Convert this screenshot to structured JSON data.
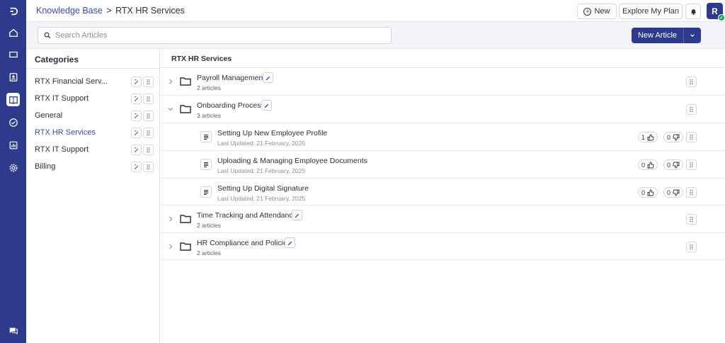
{
  "breadcrumb": {
    "root": "Knowledge Base",
    "separator": ">",
    "current": "RTX HR Services"
  },
  "header": {
    "new_label": "New",
    "plan_label": "Explore My Plan",
    "avatar_initial": "R"
  },
  "search": {
    "placeholder": "Search Articles"
  },
  "new_article": {
    "label": "New Article"
  },
  "categories": {
    "title": "Categories",
    "items": [
      {
        "label": "RTX Financial Serv..."
      },
      {
        "label": "RTX IT Support"
      },
      {
        "label": "General"
      },
      {
        "label": "RTX HR Services"
      },
      {
        "label": "RTX IT Support"
      },
      {
        "label": "Billing"
      }
    ]
  },
  "main": {
    "title": "RTX HR Services",
    "folders": [
      {
        "title": "Payroll Management",
        "count": "2 articles"
      },
      {
        "title": "Onboarding Process",
        "count": "3 articles"
      },
      {
        "title": "Time Tracking and Attendance",
        "count": "2 articles"
      },
      {
        "title": "HR Compliance and Policies",
        "count": "2 articles"
      }
    ],
    "articles": [
      {
        "title": "Setting Up New Employee Profile",
        "updated": "Last Updated: 21 February, 2025",
        "likes": "1",
        "dislikes": "0"
      },
      {
        "title": "Uploading & Managing Employee Documents",
        "updated": "Last Updated: 21 February, 2025",
        "likes": "0",
        "dislikes": "0"
      },
      {
        "title": "Setting Up Digital Signature",
        "updated": "Last Updated: 21 February, 2025",
        "likes": "0",
        "dislikes": "0"
      }
    ]
  },
  "colors": {
    "primary": "#2e3a8c",
    "link": "#3b4aa8",
    "status_online": "#22a45d"
  }
}
